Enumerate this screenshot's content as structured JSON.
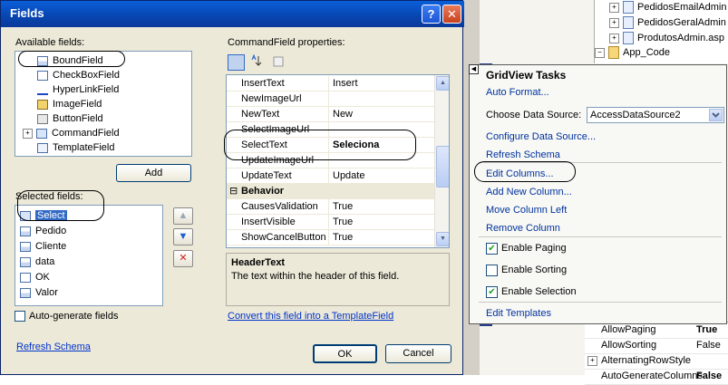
{
  "dialog": {
    "title": "Fields",
    "help_glyph": "?",
    "close_glyph": "✕",
    "available_label": "Available fields:",
    "available_fields": [
      {
        "label": "BoundField",
        "icon": "bound-field-icon"
      },
      {
        "label": "CheckBoxField",
        "icon": "checkbox-field-icon"
      },
      {
        "label": "HyperLinkField",
        "icon": "hyperlink-field-icon"
      },
      {
        "label": "ImageField",
        "icon": "image-field-icon"
      },
      {
        "label": "ButtonField",
        "icon": "button-field-icon"
      },
      {
        "label": "CommandField",
        "icon": "command-field-icon",
        "expander": "+"
      },
      {
        "label": "TemplateField",
        "icon": "template-field-icon"
      }
    ],
    "add_button": "Add",
    "selected_label": "Selected fields:",
    "selected_fields": [
      "Select",
      "Pedido",
      "Cliente",
      "data",
      "OK",
      "Valor"
    ],
    "auto_generate_label": "Auto-generate fields",
    "auto_generate_checked": false,
    "refresh_schema_link": "Refresh Schema",
    "properties_label": "CommandField properties:",
    "property_rows": [
      {
        "name": "InsertText",
        "value": "Insert"
      },
      {
        "name": "NewImageUrl",
        "value": ""
      },
      {
        "name": "NewText",
        "value": "New"
      },
      {
        "name": "SelectImageUrl",
        "value": ""
      },
      {
        "name": "SelectText",
        "value": "Seleciona"
      },
      {
        "name": "UpdateImageUrl",
        "value": ""
      },
      {
        "name": "UpdateText",
        "value": "Update"
      }
    ],
    "category": {
      "expander": "⊟",
      "name": "Behavior"
    },
    "behavior_rows": [
      {
        "name": "CausesValidation",
        "value": "True"
      },
      {
        "name": "InsertVisible",
        "value": "True"
      },
      {
        "name": "ShowCancelButton",
        "value": "True"
      }
    ],
    "description_title": "HeaderText",
    "description_text": "The text within the header of this field.",
    "convert_link": "Convert this field into a TemplateField",
    "ok_button": "OK",
    "cancel_button": "Cancel",
    "up_glyph": "▲",
    "down_glyph": "▼",
    "delete_glyph": "✕"
  },
  "tasks": {
    "title": "GridView Tasks",
    "collapse_glyph": "◀",
    "auto_format": "Auto Format...",
    "choose_source_label": "Choose Data Source:",
    "data_source_value": "AccessDataSource2",
    "configure_source": "Configure Data Source...",
    "refresh_schema": "Refresh Schema",
    "edit_columns": "Edit Columns...",
    "add_column": "Add New Column...",
    "move_left": "Move Column Left",
    "remove_column": "Remove Column",
    "enable_paging": {
      "label": "Enable Paging",
      "checked": true
    },
    "enable_sorting": {
      "label": "Enable Sorting",
      "checked": false
    },
    "enable_selection": {
      "label": "Enable Selection",
      "checked": true
    },
    "edit_templates": "Edit Templates",
    "check_glyph": "✔"
  },
  "solution_tree": {
    "items": [
      {
        "label": "PedidosEmailAdmin",
        "expander": "+"
      },
      {
        "label": "PedidosGeralAdmin",
        "expander": "+"
      },
      {
        "label": "ProdutosAdmin.asp",
        "expander": "+"
      },
      {
        "label": "App_Code",
        "expander": "−"
      }
    ]
  },
  "properties_panel": {
    "rows": [
      {
        "name": "AllowPaging",
        "value": "True",
        "bold": true
      },
      {
        "name": "AllowSorting",
        "value": "False"
      },
      {
        "name": "AlternatingRowStyle",
        "value": "",
        "expander": "+"
      },
      {
        "name": "AutoGenerateColumns",
        "value": "False"
      }
    ]
  },
  "colors": {
    "title_bar": "#0845b0",
    "dialog_bg": "#ece9d8",
    "link": "#0033cc",
    "selection": "#316ac5"
  }
}
